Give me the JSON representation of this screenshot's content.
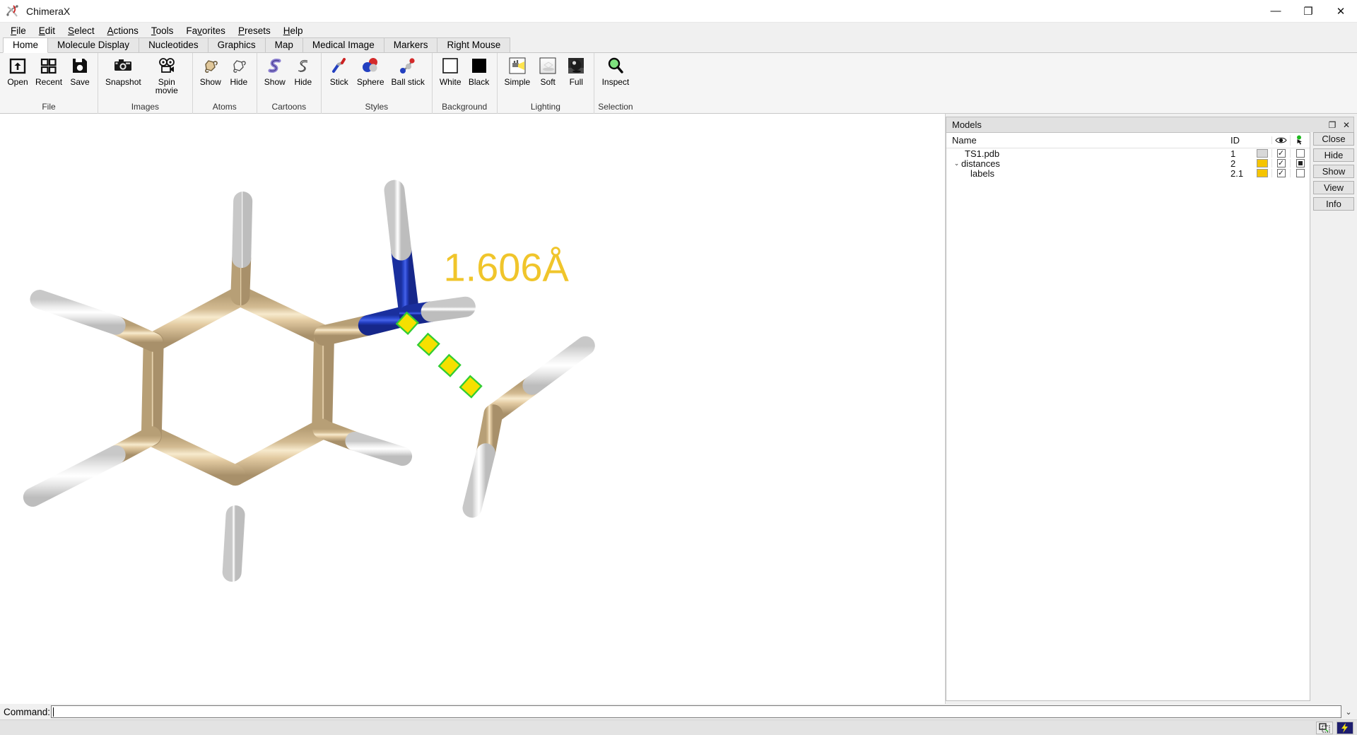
{
  "window": {
    "title": "ChimeraX",
    "app_icon": "chimerax-logo-icon",
    "controls": [
      {
        "name": "minimize-button",
        "glyph": "—"
      },
      {
        "name": "restore-button",
        "glyph": "❐"
      },
      {
        "name": "close-button",
        "glyph": "✕"
      }
    ]
  },
  "menubar": {
    "items": [
      {
        "label": "File",
        "mnemonic": "F"
      },
      {
        "label": "Edit",
        "mnemonic": "E"
      },
      {
        "label": "Select",
        "mnemonic": "S"
      },
      {
        "label": "Actions",
        "mnemonic": "A"
      },
      {
        "label": "Tools",
        "mnemonic": "T"
      },
      {
        "label": "Favorites",
        "mnemonic": "v"
      },
      {
        "label": "Presets",
        "mnemonic": "P"
      },
      {
        "label": "Help",
        "mnemonic": "H"
      }
    ]
  },
  "ribbon": {
    "tabs": [
      {
        "label": "Home",
        "active": true
      },
      {
        "label": "Molecule Display",
        "active": false
      },
      {
        "label": "Nucleotides",
        "active": false
      },
      {
        "label": "Graphics",
        "active": false
      },
      {
        "label": "Map",
        "active": false
      },
      {
        "label": "Medical Image",
        "active": false
      },
      {
        "label": "Markers",
        "active": false
      },
      {
        "label": "Right Mouse",
        "active": false
      }
    ],
    "groups": [
      {
        "label": "File",
        "buttons": [
          {
            "label": "Open",
            "icon": "open-folder-arrow-icon"
          },
          {
            "label": "Recent",
            "icon": "recent-grid-icon"
          },
          {
            "label": "Save",
            "icon": "save-floppy-icon"
          }
        ]
      },
      {
        "label": "Images",
        "buttons": [
          {
            "label": "Snapshot",
            "icon": "camera-icon"
          },
          {
            "label": "Spin movie",
            "icon": "movie-camera-icon"
          }
        ]
      },
      {
        "label": "Atoms",
        "buttons": [
          {
            "label": "Show",
            "icon": "atoms-show-icon"
          },
          {
            "label": "Hide",
            "icon": "atoms-hide-icon"
          }
        ]
      },
      {
        "label": "Cartoons",
        "buttons": [
          {
            "label": "Show",
            "icon": "cartoon-show-icon"
          },
          {
            "label": "Hide",
            "icon": "cartoon-hide-icon"
          }
        ]
      },
      {
        "label": "Styles",
        "buttons": [
          {
            "label": "Stick",
            "icon": "stick-style-icon"
          },
          {
            "label": "Sphere",
            "icon": "sphere-style-icon"
          },
          {
            "label": "Ball stick",
            "icon": "ball-stick-style-icon"
          }
        ]
      },
      {
        "label": "Background",
        "buttons": [
          {
            "label": "White",
            "icon": "white-swatch-icon"
          },
          {
            "label": "Black",
            "icon": "black-swatch-icon"
          }
        ]
      },
      {
        "label": "Lighting",
        "buttons": [
          {
            "label": "Simple",
            "icon": "simple-lighting-icon"
          },
          {
            "label": "Soft",
            "icon": "soft-lighting-icon"
          },
          {
            "label": "Full",
            "icon": "full-lighting-icon"
          }
        ]
      },
      {
        "label": "Selection",
        "buttons": [
          {
            "label": "Inspect",
            "icon": "magnifier-inspect-icon"
          }
        ]
      }
    ]
  },
  "models_panel": {
    "title": "Models",
    "titlebar_buttons": [
      {
        "name": "undock-button",
        "glyph": "❐"
      },
      {
        "name": "panel-close-button",
        "glyph": "✕"
      }
    ],
    "columns": {
      "name": "Name",
      "id": "ID",
      "color": "",
      "shown": "eye-icon",
      "select": "select-pointer-icon"
    },
    "rows": [
      {
        "name": "TS1.pdb",
        "id": "1",
        "indent": 1,
        "twisty": "",
        "color": "#d8d8d8",
        "shown": true,
        "selected": "none"
      },
      {
        "name": "distances",
        "id": "2",
        "indent": 0,
        "twisty": "⌄",
        "color": "#f5c400",
        "shown": true,
        "selected": "partial"
      },
      {
        "name": "labels",
        "id": "2.1",
        "indent": 2,
        "twisty": "",
        "color": "#f5c400",
        "shown": true,
        "selected": "none"
      }
    ],
    "buttons": [
      {
        "label": "Close"
      },
      {
        "label": "Hide"
      },
      {
        "label": "Show"
      },
      {
        "label": "View"
      },
      {
        "label": "Info"
      }
    ]
  },
  "viewport": {
    "background": "#ffffff",
    "distance_label": "1.606Å",
    "colors": {
      "carbon": "#c9ab7d",
      "carbon_light": "#f0ddbb",
      "nitrogen": "#2442cc",
      "nitrogen_light": "#4a66e0",
      "hydrogen": "#f2f2f2",
      "hydrogen_shade": "#cfcfcf",
      "distance_dash": "#f5e000",
      "distance_outline": "#32cd32",
      "label_text": "#f0c52b"
    }
  },
  "command_line": {
    "label": "Command:",
    "value": "",
    "placeholder": "",
    "dropdown_glyph": "⌄"
  },
  "status_bar": {
    "icons": [
      {
        "name": "selection-region-icon"
      },
      {
        "name": "lightning-bolt-icon"
      }
    ]
  }
}
